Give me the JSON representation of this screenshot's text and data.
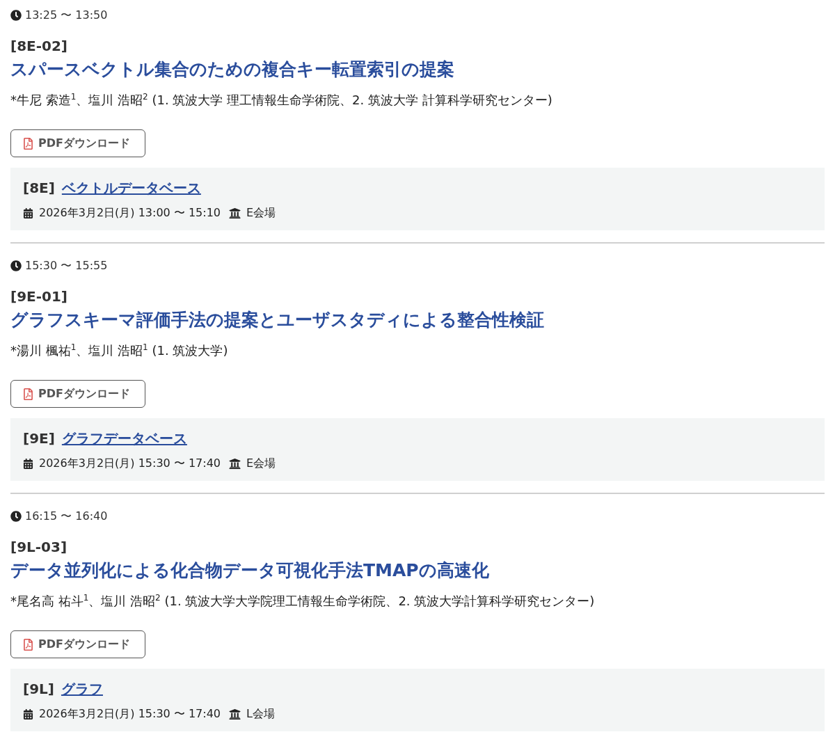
{
  "entries": [
    {
      "time": "13:25 〜 13:50",
      "code": "[8E-02]",
      "title": "スパースベクトル集合のための複合キー転置索引の提案",
      "authors": "*牛尼 索造$^{1}$、塩川 浩昭$^{2}$ (1. 筑波大学 理工情報生命学術院、2. 筑波大学 計算科学研究センター)",
      "pdf_button": "PDFダウンロード",
      "session": {
        "code": "[8E]",
        "name": "ベクトルデータベース",
        "date": "2026年3月2日(月) 13:00 〜 15:10",
        "room": "E会場"
      }
    },
    {
      "time": "15:30 〜 15:55",
      "code": "[9E-01]",
      "title": "グラフスキーマ評価手法の提案とユーザスタディによる整合性検証",
      "authors": "*湯川 楓祐$^{1}$、塩川 浩昭$^{1}$ (1. 筑波大学)",
      "pdf_button": "PDFダウンロード",
      "session": {
        "code": "[9E]",
        "name": "グラフデータベース",
        "date": "2026年3月2日(月) 15:30 〜 17:40",
        "room": "E会場"
      }
    },
    {
      "time": "16:15 〜 16:40",
      "code": "[9L-03]",
      "title": "データ並列化による化合物データ可視化手法TMAPの高速化",
      "authors": "*尾名高 祐斗$^{1}$、塩川 浩昭$^{2}$ (1. 筑波大学大学院理工情報生命学術院、2. 筑波大学計算科学研究センター)",
      "pdf_button": "PDFダウンロード",
      "session": {
        "code": "[9L]",
        "name": "グラフ",
        "date": "2026年3月2日(月) 15:30 〜 17:40",
        "room": "L会場"
      }
    }
  ]
}
